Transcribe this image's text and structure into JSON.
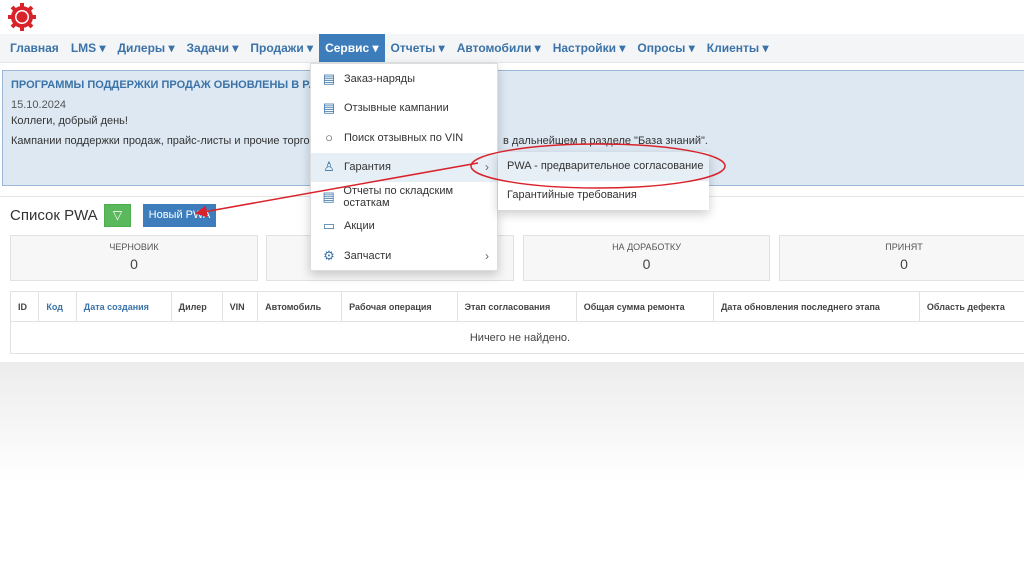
{
  "nav": {
    "items": [
      "Главная",
      "LMS ▾",
      "Дилеры ▾",
      "Задачи ▾",
      "Продажи ▾",
      "Сервис ▾",
      "Отчеты ▾",
      "Автомобили ▾",
      "Настройки ▾",
      "Опросы ▾",
      "Клиенты ▾"
    ],
    "active": 5
  },
  "banner": {
    "title": "ПРОГРАММЫ ПОДДЕРЖКИ ПРОДАЖ ОБНОВЛЕНЫ В РАЗДЕЛЕ \"",
    "date": "15.10.2024",
    "greeting": "Коллеги, добрый день!",
    "text_start": "Кампании поддержки продаж, прайс-листы и прочие торговые у",
    "text_end": "в дальнейшем в разделе \"База знаний\"."
  },
  "list": {
    "title": "Список PWA",
    "new_button": "Новый PWA"
  },
  "cards": [
    {
      "label": "ЧЕРНОВИК",
      "value": "0"
    },
    {
      "label": "НА ДОРАБОТКУ",
      "value": "0"
    },
    {
      "label": "ПРИНЯТ",
      "value": "0"
    }
  ],
  "table": {
    "headers": [
      "ID",
      "Код",
      "Дата создания",
      "Дилер",
      "VIN",
      "Автомобиль",
      "Рабочая операция",
      "Этап согласования",
      "Общая сумма ремонта",
      "Дата обновления последнего этапа",
      "Область дефекта"
    ],
    "empty": "Ничего не найдено."
  },
  "menu": {
    "items": [
      "Заказ-наряды",
      "Отзывные кампании",
      "Поиск отзывных по VIN",
      "Гарантия",
      "Отчеты по складским остаткам",
      "Акции",
      "Запчасти"
    ]
  },
  "submenu": {
    "items": [
      "PWA - предварительное согласование",
      "Гарантийные требования"
    ]
  },
  "colors": {
    "accent": "#3d7dbb",
    "annotation": "#d9232a"
  }
}
